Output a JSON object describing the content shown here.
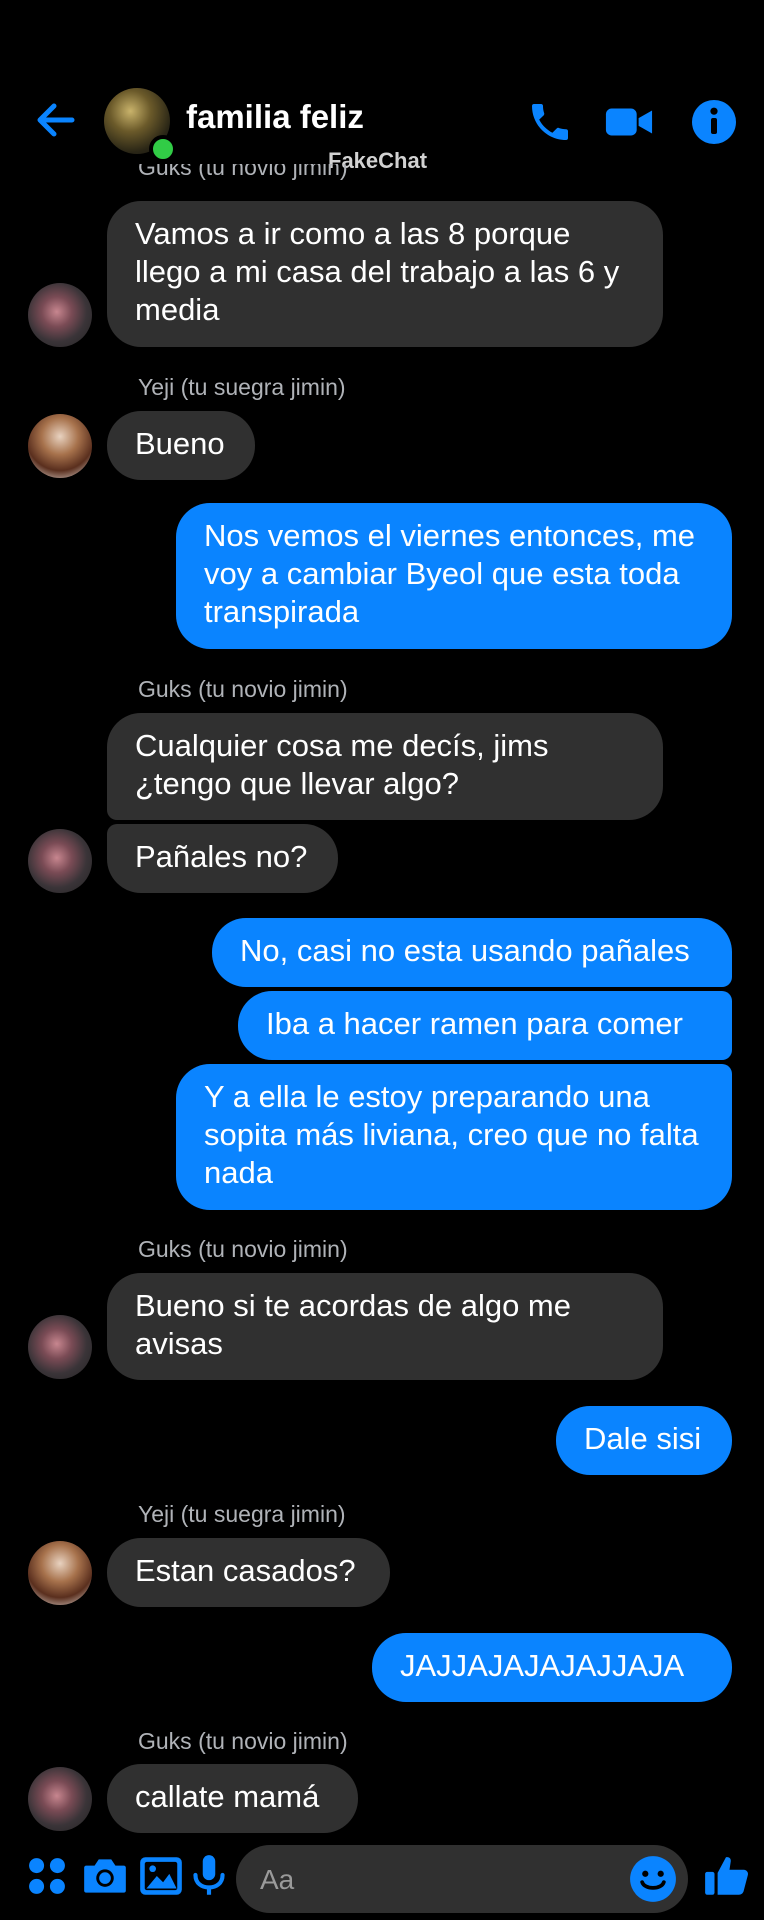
{
  "header": {
    "title": "familia feliz",
    "watermark": "FakeChat",
    "icons": [
      "back-arrow-icon",
      "phone-icon",
      "video-camera-icon",
      "info-icon"
    ]
  },
  "colors": {
    "accent": "#0a84ff",
    "incoming": "#303030",
    "online": "#31cc46"
  },
  "messages": {
    "top_sender_partial": "Guks (tu novio jimin)",
    "m1": "Vamos a ir como a las 8 porque llego a mi casa del trabajo a las 6 y media",
    "s2": "Yeji (tu suegra jimin)",
    "m2": "Bueno",
    "m3": "Nos vemos el viernes entonces, me voy a cambiar Byeol que esta toda transpirada",
    "s4": "Guks (tu novio jimin)",
    "m4a": "Cualquier cosa me decís, jims ¿tengo que llevar algo?",
    "m4b": "Pañales no?",
    "m5a": "No, casi no esta usando pañales",
    "m5b": "Iba a hacer ramen para comer",
    "m5c": "Y a ella le estoy preparando una sopita más liviana, creo que no falta nada",
    "s6": "Guks (tu novio jimin)",
    "m6": "Bueno si te acordas de algo me avisas",
    "m7": "Dale sisi",
    "s8": "Yeji (tu suegra jimin)",
    "m8": "Estan casados?",
    "m9": "JAJJAJAJAJAJJAJA",
    "s10": "Guks (tu novio jimin)",
    "m10": "callate mamá"
  },
  "composer": {
    "placeholder": "Aa",
    "icons": [
      "apps-grid-icon",
      "camera-icon",
      "gallery-icon",
      "microphone-icon",
      "emoji-icon",
      "like-thumb-icon"
    ]
  }
}
